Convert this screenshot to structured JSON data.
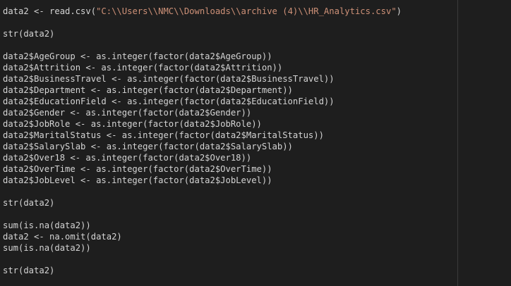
{
  "editor": {
    "lines": [
      {
        "pre": "data2 <- read.csv(",
        "str": "\"C:\\\\Users\\\\NMC\\\\Downloads\\\\archive (4)\\\\HR_Analytics.csv\"",
        "post": ")"
      },
      {
        "pre": ""
      },
      {
        "pre": "str(data2)"
      },
      {
        "pre": ""
      },
      {
        "pre": "data2$AgeGroup <- as.integer(factor(data2$AgeGroup))"
      },
      {
        "pre": "data2$Attrition <- as.integer(factor(data2$Attrition))"
      },
      {
        "pre": "data2$BusinessTravel <- as.integer(factor(data2$BusinessTravel))"
      },
      {
        "pre": "data2$Department <- as.integer(factor(data2$Department))"
      },
      {
        "pre": "data2$EducationField <- as.integer(factor(data2$EducationField))"
      },
      {
        "pre": "data2$Gender <- as.integer(factor(data2$Gender))"
      },
      {
        "pre": "data2$JobRole <- as.integer(factor(data2$JobRole))"
      },
      {
        "pre": "data2$MaritalStatus <- as.integer(factor(data2$MaritalStatus))"
      },
      {
        "pre": "data2$SalarySlab <- as.integer(factor(data2$SalarySlab))"
      },
      {
        "pre": "data2$Over18 <- as.integer(factor(data2$Over18))"
      },
      {
        "pre": "data2$OverTime <- as.integer(factor(data2$OverTime))"
      },
      {
        "pre": "data2$JobLevel <- as.integer(factor(data2$JobLevel))"
      },
      {
        "pre": ""
      },
      {
        "pre": "str(data2)"
      },
      {
        "pre": ""
      },
      {
        "pre": "sum(is.na(data2))"
      },
      {
        "pre": "data2 <- na.omit(data2)"
      },
      {
        "pre": "sum(is.na(data2))"
      },
      {
        "pre": ""
      },
      {
        "pre": "str(data2)"
      }
    ]
  }
}
